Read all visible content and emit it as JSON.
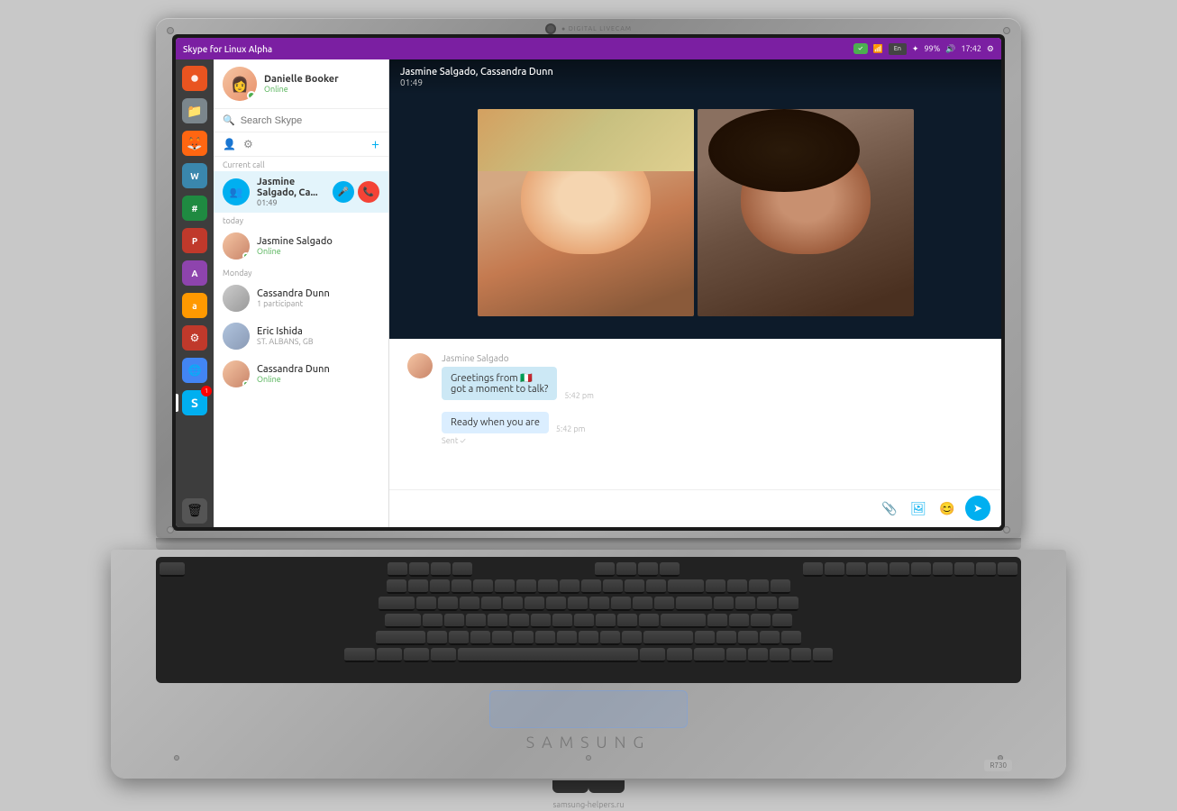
{
  "window": {
    "title": "Skype for Linux Alpha"
  },
  "profile": {
    "name": "Danielle Booker",
    "status": "Online"
  },
  "search": {
    "placeholder": "Search Skype"
  },
  "currentCall": {
    "label": "Current call",
    "name": "Jasmine Salgado, Ca...",
    "timer": "01:49"
  },
  "sections": {
    "today": "today",
    "monday": "Monday"
  },
  "contacts": [
    {
      "name": "Jasmine Salgado",
      "sub": "Online",
      "subType": "online",
      "avatarClass": "av-jasmine"
    },
    {
      "name": "Cassandra Dunn",
      "sub": "1 participant",
      "subType": "normal",
      "avatarClass": "av-cassandra"
    },
    {
      "name": "Eric Ishida",
      "sub": "ST. ALBANS, GB",
      "subType": "normal",
      "avatarClass": "av-eric"
    },
    {
      "name": "Cassandra Dunn",
      "sub": "Online",
      "subType": "online",
      "avatarClass": "av-jasmine"
    }
  ],
  "chatHeader": {
    "title": "Jasmine Salgado, Cassandra Dunn",
    "timer": "01:49"
  },
  "messages": [
    {
      "sender": "Jasmine Salgado",
      "bubbles": [
        "Greetings from 🇮🇹",
        "got a moment to talk?"
      ],
      "time": "5:42 pm",
      "type": "received"
    },
    {
      "text": "Ready when you are",
      "time": "5:42 pm",
      "status": "Sent ✓",
      "type": "sent"
    }
  ],
  "inputPlaceholder": "",
  "systemTray": {
    "indicator": "En",
    "battery": "99%",
    "time": "17:42"
  },
  "brand": "SAMSUNG",
  "model": "R730",
  "watermark": "samsung-helpers.ru"
}
